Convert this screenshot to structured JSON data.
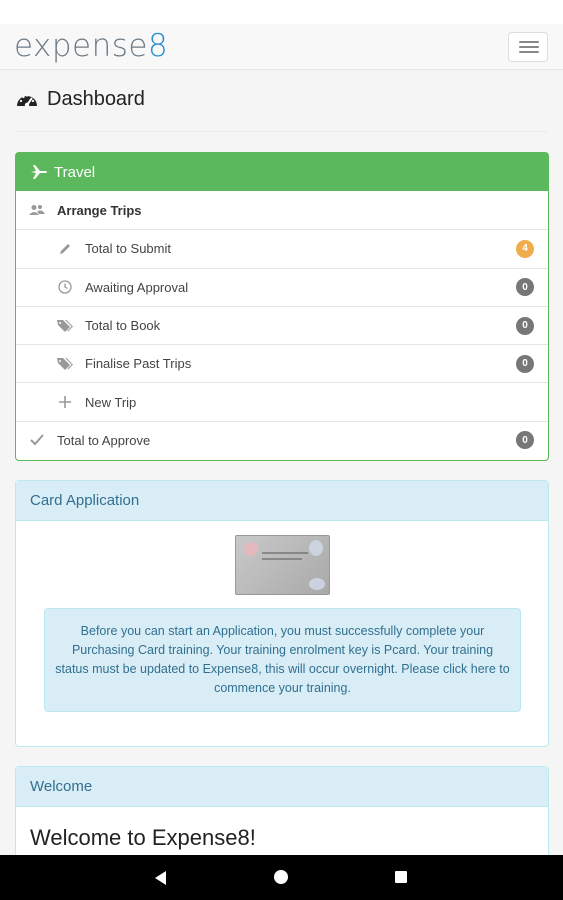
{
  "app": {
    "logo_text": "expense",
    "logo_accent": "8"
  },
  "page": {
    "title": "Dashboard"
  },
  "travel": {
    "title": "Travel",
    "items": [
      {
        "label": "Arrange Trips",
        "icon": "users-icon"
      },
      {
        "label": "Total to Submit",
        "icon": "pencil-icon",
        "badge": "4"
      },
      {
        "label": "Awaiting Approval",
        "icon": "clock-icon",
        "badge": "0"
      },
      {
        "label": "Total to Book",
        "icon": "tags-icon",
        "badge": "0"
      },
      {
        "label": "Finalise Past Trips",
        "icon": "tags-icon",
        "badge": "0"
      },
      {
        "label": "New Trip",
        "icon": "plus-icon"
      },
      {
        "label": "Total to Approve",
        "icon": "check-icon",
        "badge": "0"
      }
    ]
  },
  "card_application": {
    "title": "Card Application",
    "message": "Before you can start an Application, you must successfully complete your Purchasing Card training. Your training enrolment key is Pcard. Your training status must be updated to Expense8, this will occur overnight. Please click here to commence your training."
  },
  "welcome": {
    "title": "Welcome",
    "heading": "Welcome to Expense8!"
  },
  "colors": {
    "success": "#5cb85c",
    "info_bg": "#d9edf7",
    "info_text": "#31708f",
    "badge_warning": "#f0ad4e",
    "badge_default": "#777777",
    "logo_accent": "#2a8fd0"
  }
}
